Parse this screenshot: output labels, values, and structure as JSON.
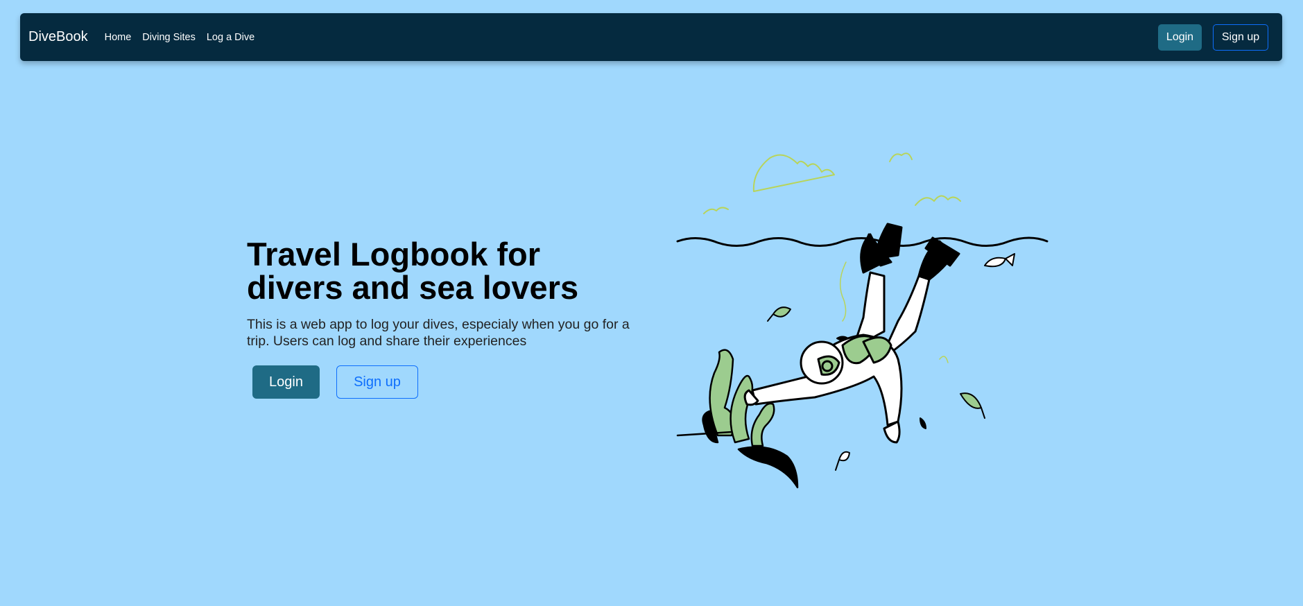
{
  "navbar": {
    "brand": "DiveBook",
    "links": [
      "Home",
      "Diving Sites",
      "Log a Dive"
    ],
    "login_label": "Login",
    "signup_label": "Sign up"
  },
  "hero": {
    "title": "Travel Logbook for divers and sea lovers",
    "description": "This is a web app to log your dives, especialy when you go for a trip. Users can log and share their experiences",
    "login_label": "Login",
    "signup_label": "Sign up"
  },
  "illustration": {
    "icon": "scuba-diver-illustration",
    "colors": {
      "accent_green": "#9ccc8f",
      "cloud": "#c8e06a",
      "ink": "#000000"
    }
  },
  "colors": {
    "background": "#a0d8fd",
    "navbar": "#052a3f",
    "primary_button": "#1f6b85",
    "outline_button": "#0d6efd"
  }
}
